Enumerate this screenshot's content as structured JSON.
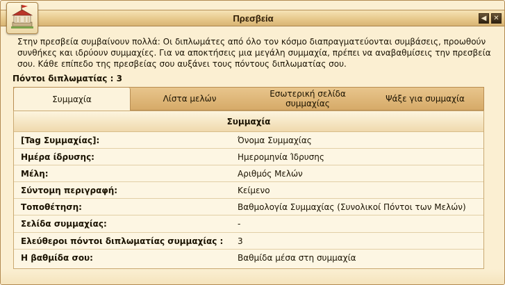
{
  "window": {
    "title": "Πρεσβεία",
    "back_icon": "arrow-left-icon",
    "close_icon": "close-icon"
  },
  "intro": "Στην πρεσβεία συμβαίνουν πολλά: Οι διπλωμάτες από όλο τον κόσμο διαπραγματεύονται συμβάσεις, προωθούν συνθήκες και ιδρύουν συμμαχίες. Για να αποκτήσεις μια μεγάλη συμμαχία, πρέπει να αναβαθμίσεις την πρεσβεία σου. Κάθε επίπεδο της πρεσβείας σου αυξάνει τους πόντους διπλωματίας σου.",
  "points": {
    "label": "Πόντοι διπλωματίας :",
    "value": "3"
  },
  "tabs": [
    {
      "label": "Συμμαχία",
      "active": true
    },
    {
      "label": "Λίστα μελών",
      "active": false
    },
    {
      "label": "Εσωτερική σελίδα συμμαχίας",
      "active": false
    },
    {
      "label": "Ψάξε για συμμαχία",
      "active": false
    }
  ],
  "alliance": {
    "heading": "Συμμαχία",
    "rows": [
      {
        "label": "[Tag Συμμαχίας]:",
        "value": "Όνομα Συμμαχίας"
      },
      {
        "label": "Ημέρα ίδρυσης:",
        "value": "Ημερομηνία Ίδρυσης"
      },
      {
        "label": "Μέλη:",
        "value": "Αριθμός Μελών"
      },
      {
        "label": "Σύντομη περιγραφή:",
        "value": "Κείμενο"
      },
      {
        "label": "Τοποθέτηση:",
        "value": "Βαθμολογία Συμμαχίας (Συνολικοί Πόντοι των Μελών)"
      },
      {
        "label": "Σελίδα συμμαχίας:",
        "value": "-"
      },
      {
        "label": "Ελεύθεροι πόντοι διπλωματίας συμμαχίας :",
        "value": "3"
      },
      {
        "label": "Η βαθμίδα σου:",
        "value": "Βαθμίδα μέσα στη συμμαχία"
      }
    ]
  },
  "colors": {
    "accent": "#d6aa68",
    "background": "#fbefd2",
    "close_button": "#2c200f"
  }
}
